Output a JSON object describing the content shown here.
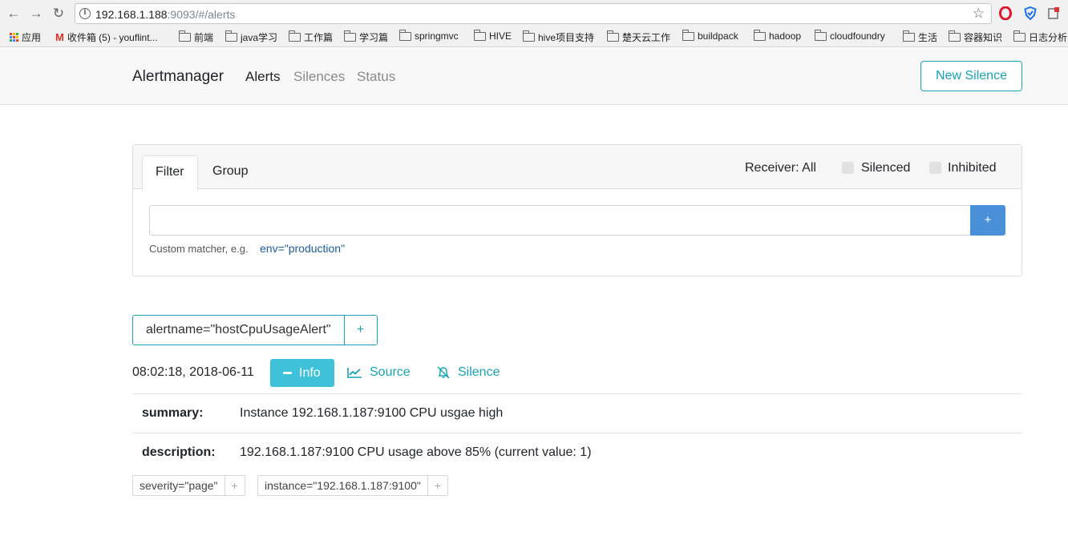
{
  "browser": {
    "url_host": "192.168.1.188",
    "url_rest": ":9093/#/alerts",
    "bookmarks": [
      "应用",
      "收件箱 (5) - youflint...",
      "前端",
      "java学习",
      "工作篇",
      "学习篇",
      "springmvc",
      "HIVE",
      "hive项目支持",
      "楚天云工作",
      "buildpack",
      "hadoop",
      "cloudfoundry",
      "生活",
      "容器知识",
      "日志分析"
    ]
  },
  "navbar": {
    "brand": "Alertmanager",
    "links": [
      "Alerts",
      "Silences",
      "Status"
    ],
    "new_silence": "New Silence"
  },
  "filter": {
    "tabs": [
      "Filter",
      "Group"
    ],
    "receiver": "Receiver: All",
    "silenced": "Silenced",
    "inhibited": "Inhibited",
    "input_value": "",
    "add_label": "+",
    "hint": "Custom matcher, e.g.",
    "hint_example": "env=\"production\""
  },
  "group": {
    "label": "alertname=\"hostCpuUsageAlert\"",
    "plus": "+"
  },
  "alert": {
    "timestamp": "08:02:18, 2018-06-11",
    "info": "Info",
    "source": "Source",
    "silence": "Silence",
    "annotations": [
      {
        "key": "summary:",
        "value": "Instance 192.168.1.187:9100 CPU usgae high"
      },
      {
        "key": "description:",
        "value": "192.168.1.187:9100 CPU usage above 85% (current value: 1)"
      }
    ],
    "labels": [
      "severity=\"page\"",
      "instance=\"192.168.1.187:9100\""
    ],
    "label_plus": "+"
  },
  "colors": {
    "accent": "#17a2b8",
    "info_button": "#3ec1d9",
    "add_button": "#4a90d9"
  }
}
